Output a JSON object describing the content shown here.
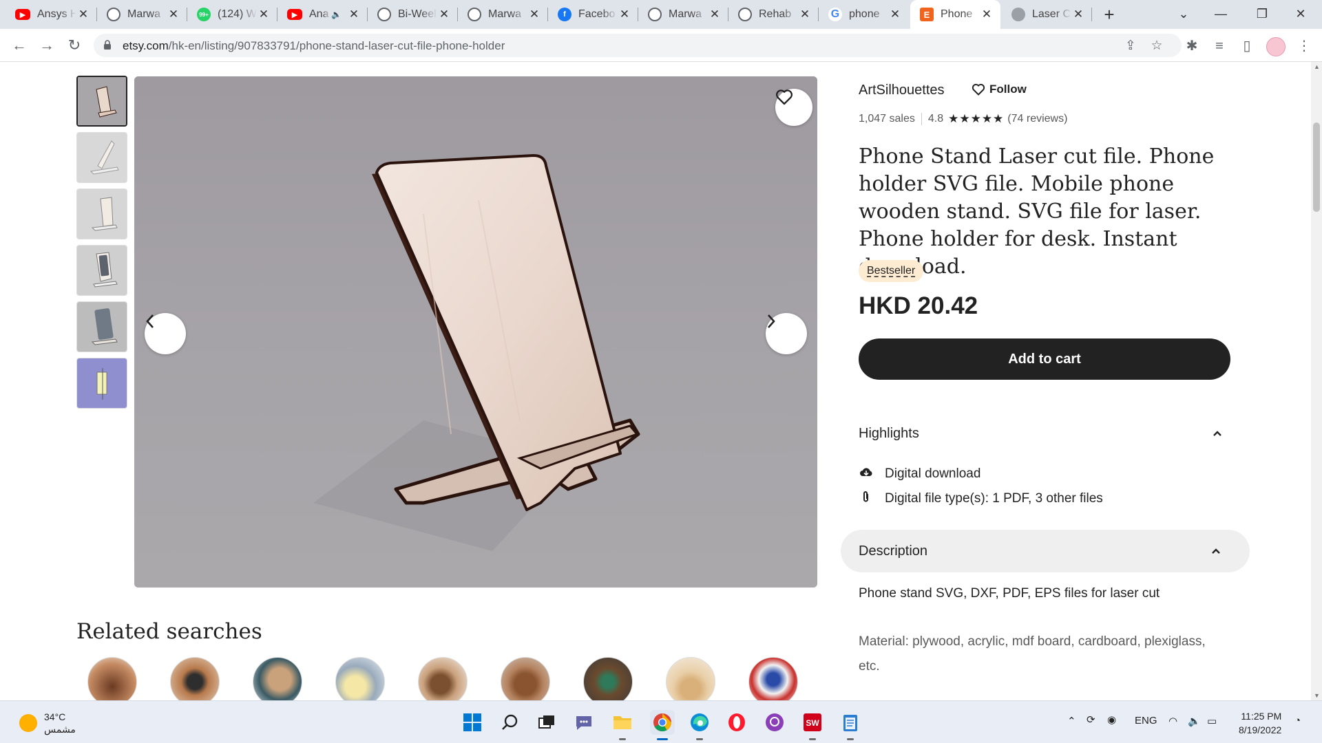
{
  "browser": {
    "tabs": [
      {
        "title": "Ansys H",
        "icon": "youtube-icon"
      },
      {
        "title": "Marwa",
        "icon": "globe-icon"
      },
      {
        "title": "(124) W",
        "icon": "whatsapp-icon",
        "badge": "99+"
      },
      {
        "title": "Ana",
        "icon": "youtube-icon",
        "audio": true
      },
      {
        "title": "Bi-Weel",
        "icon": "globe-icon"
      },
      {
        "title": "Marwa",
        "icon": "globe-icon"
      },
      {
        "title": "Facebo",
        "icon": "facebook-icon"
      },
      {
        "title": "Marwa",
        "icon": "globe-icon"
      },
      {
        "title": "Rehab",
        "icon": "globe-icon"
      },
      {
        "title": "phone",
        "icon": "google-icon"
      },
      {
        "title": "Phone",
        "icon": "etsy-icon",
        "active": true
      },
      {
        "title": "Laser C",
        "icon": "laser-icon"
      }
    ],
    "url_domain": "etsy.com",
    "url_path": "/hk-en/listing/907833791/phone-stand-laser-cut-file-phone-holder"
  },
  "product": {
    "shop_name": "ArtSilhouettes",
    "follow_label": "Follow",
    "sales": "1,047 sales",
    "rating": "4.8",
    "stars": "★★★★★",
    "reviews": "(74 reviews)",
    "title": "Phone Stand Laser cut file. Phone holder SVG file. Mobile phone wooden stand. SVG file for laser. Phone holder for desk. Instant download.",
    "badge": "Bestseller",
    "price": "HKD 20.42",
    "cart_label": "Add to cart",
    "highlights_label": "Highlights",
    "highlights": [
      {
        "icon": "cloud-download-icon",
        "text": "Digital download"
      },
      {
        "icon": "paperclip-icon",
        "text": "Digital file type(s): 1 PDF, 3 other files"
      }
    ],
    "description_label": "Description",
    "description_lines": [
      "Phone stand SVG, DXF, PDF, EPS files for laser cut",
      "Material: plywood, acrylic, mdf board, cardboard, plexiglass, etc."
    ]
  },
  "related": {
    "title": "Related searches"
  },
  "taskbar": {
    "temperature": "34°C",
    "weather_desc": "مشمس",
    "language": "ENG",
    "time": "11:25 PM",
    "date": "8/19/2022"
  },
  "colors": {
    "accent_dark": "#222222",
    "badge_bg": "#fdebd2",
    "etsy_orange": "#f1641e",
    "tab_strip": "#dfe3ea"
  }
}
